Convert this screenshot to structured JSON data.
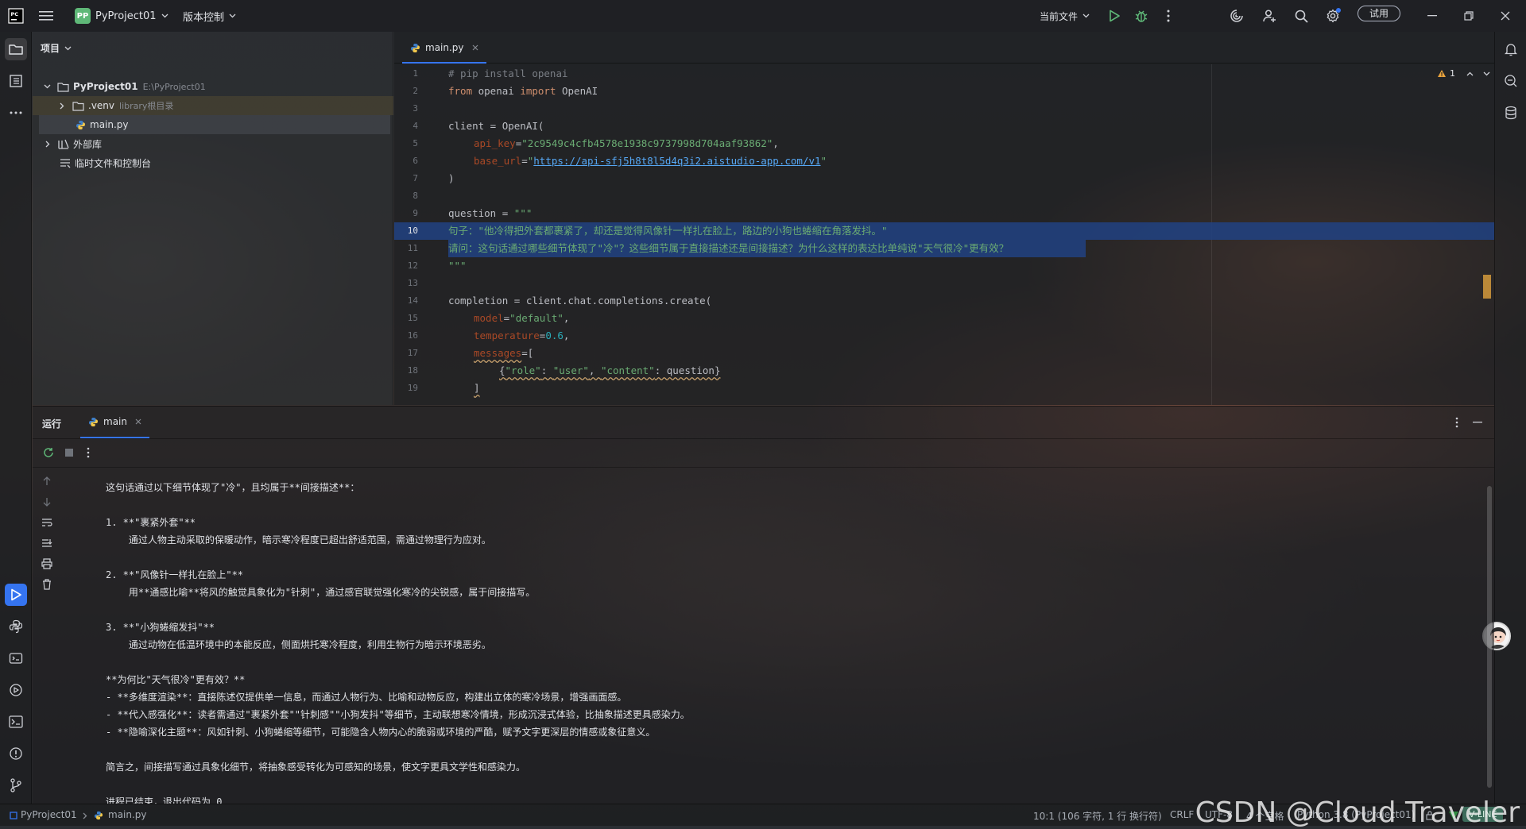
{
  "titlebar": {
    "project_badge": "PP",
    "project_name": "PyProject01",
    "vcs_label": "版本控制",
    "run_config": "当前文件",
    "trial_label": "试用"
  },
  "project_panel": {
    "title": "项目",
    "items": [
      {
        "label": "PyProject01",
        "path": "E:\\PyProject01"
      },
      {
        "label": ".venv",
        "hint": "library根目录"
      },
      {
        "label": "main.py"
      },
      {
        "label": "外部库"
      },
      {
        "label": "临时文件和控制台"
      }
    ]
  },
  "editor": {
    "tab_label": "main.py",
    "warning_count": "1",
    "line_numbers": [
      "1",
      "2",
      "3",
      "4",
      "5",
      "6",
      "7",
      "8",
      "9",
      "10",
      "11",
      "12",
      "13",
      "14",
      "15",
      "16",
      "17",
      "18",
      "19"
    ],
    "code": {
      "l1": "# pip install openai",
      "l2_kw1": "from",
      "l2_mid": " openai ",
      "l2_kw2": "import",
      "l2_end": " OpenAI",
      "l4": "client = OpenAI(",
      "l5_param": "api_key",
      "l5_eq": "=",
      "l5_str": "\"2c9549c4cfb4578e1938c9737998d704aaf93862\"",
      "l5_end": ",",
      "l6_param": "base_url",
      "l6_eq": "=",
      "l6_q1": "\"",
      "l6_url": "https://api-sfj5h8t8l5d4q3i2.aistudio-app.com/v1",
      "l6_q2": "\"",
      "l7": ")",
      "l9_a": "question = ",
      "l9_str": "\"\"\"",
      "l10": "句子：\"他冷得把外套都裹紧了，却还是觉得风像针一样扎在脸上，路边的小狗也蜷缩在角落发抖。\"",
      "l11": "请问：这句话通过哪些细节体现了\"冷\"？这些细节属于直接描述还是间接描述？为什么这样的表达比单纯说\"天气很冷\"更有效？",
      "l12": "\"\"\"",
      "l14": "completion = client.chat.completions.create(",
      "l15_param": "model",
      "l15_eq": "=",
      "l15_str": "\"default\"",
      "l15_end": ",",
      "l16_param": "temperature",
      "l16_eq": "=",
      "l16_num": "0.6",
      "l16_end": ",",
      "l17_param": "messages",
      "l17_end": "=[",
      "l18_a": "{",
      "l18_s1": "\"role\"",
      "l18_b": ": ",
      "l18_s2": "\"user\"",
      "l18_c": ", ",
      "l18_s3": "\"content\"",
      "l18_d": ": question}",
      "l19": "]"
    }
  },
  "run_panel": {
    "title": "运行",
    "tab_label": "main",
    "output": [
      "这句话通过以下细节体现了\"冷\"，且均属于**间接描述**：",
      "",
      "1. **\"裹紧外套\"**",
      "    通过人物主动采取的保暖动作，暗示寒冷程度已超出舒适范围，需通过物理行为应对。",
      "",
      "2. **\"风像针一样扎在脸上\"**",
      "    用**通感比喻**将风的触觉具象化为\"针刺\"，通过感官联觉强化寒冷的尖锐感，属于间接描写。",
      "",
      "3. **\"小狗蜷缩发抖\"**",
      "    通过动物在低温环境中的本能反应，侧面烘托寒冷程度，利用生物行为暗示环境恶劣。",
      "",
      "**为何比\"天气很冷\"更有效？**",
      "- **多维度渲染**：直接陈述仅提供单一信息，而通过人物行为、比喻和动物反应，构建出立体的寒冷场景，增强画面感。",
      "- **代入感强化**：读者需通过\"裹紧外套\"\"针刺感\"\"小狗发抖\"等细节，主动联想寒冷情境，形成沉浸式体验，比抽象描述更具感染力。",
      "- **隐喻深化主题**：风如针刺、小狗蜷缩等细节，可能隐含人物内心的脆弱或环境的严酷，赋予文字更深层的情感或象征意义。",
      "",
      "简言之，间接描写通过具象化细节，将抽象感受转化为可感知的场景，使文字更具文学性和感染力。",
      "",
      "进程已结束，退出代码为 0"
    ]
  },
  "statusbar": {
    "crumb_project": "PyProject01",
    "crumb_file": "main.py",
    "position": "10:1 (106 字符, 1 行 换行符)",
    "line_sep": "CRLF",
    "encoding": "UTF-8",
    "indent": "4 个空格",
    "interpreter": "Python 3.8 (PyProject01)",
    "mode": "V-LINE"
  },
  "watermark": "CSDN @Cloud Traveler"
}
